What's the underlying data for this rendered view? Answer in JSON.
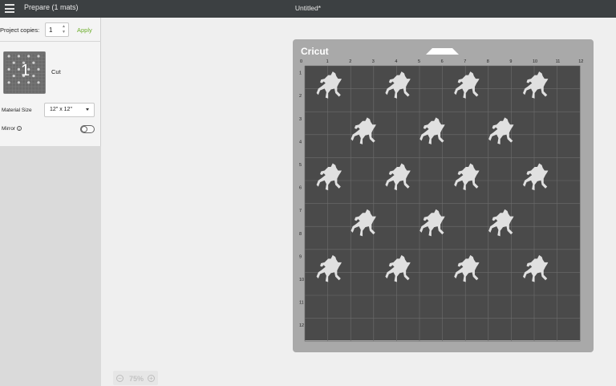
{
  "topbar": {
    "prepare_title": "Prepare (1 mats)",
    "document_title": "Untitled*"
  },
  "sidebar": {
    "copies_label": "Project copies:",
    "copies_value": "1",
    "apply_label": "Apply",
    "mat_number": "1",
    "mat_label": "Cut",
    "material_label": "Material Size",
    "material_value": "12\" x 12\"",
    "mirror_label": "Mirror",
    "mirror_on": false
  },
  "zoom": {
    "value": "75%",
    "out_symbol": "−",
    "in_symbol": "+"
  },
  "mat": {
    "brand": "Cricut",
    "columns": [
      "0",
      "1",
      "2",
      "3",
      "4",
      "5",
      "6",
      "7",
      "8",
      "9",
      "10",
      "11",
      "12"
    ],
    "rows": [
      "0",
      "1",
      "2",
      "3",
      "4",
      "5",
      "6",
      "7",
      "8",
      "9",
      "10",
      "11",
      "12"
    ],
    "unicorn_rows": [
      [
        1,
        4,
        7,
        10
      ],
      [
        2.5,
        5.5,
        8.5
      ],
      [
        1,
        4,
        7,
        10
      ],
      [
        2.5,
        5.5,
        8.5
      ],
      [
        1,
        4,
        7,
        10
      ]
    ]
  },
  "colors": {
    "topbar": "#3c4042",
    "accent_green": "#6cae2a",
    "mat_frame": "#a9a9a9",
    "mat_surface": "#4a4a4a",
    "grid_line": "#6d6d6d",
    "unicorn": "#e0e0e0"
  }
}
